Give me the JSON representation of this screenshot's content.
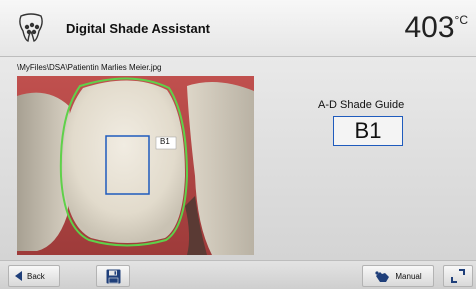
{
  "header": {
    "app_title": "Digital Shade Assistant",
    "temperature_value": "403",
    "temperature_unit": "°C",
    "icon": "teeth-dots-icon"
  },
  "main": {
    "file_path": "\\MyFiles\\DSA\\Patientin Marlies Meier.jpg",
    "photo_label": "B1",
    "shade_guide_title": "A-D Shade Guide",
    "shade_value": "B1"
  },
  "footer": {
    "back_label": "Back",
    "back_icon": "triangle-left-icon",
    "save_icon": "floppy-disk-icon",
    "manual_label": "Manual",
    "manual_icon": "hand-pointer-icon",
    "expand_icon": "corner-expand-icon"
  },
  "colors": {
    "accent_blue": "#1f5bbd",
    "outline_green": "#5fd14a"
  }
}
